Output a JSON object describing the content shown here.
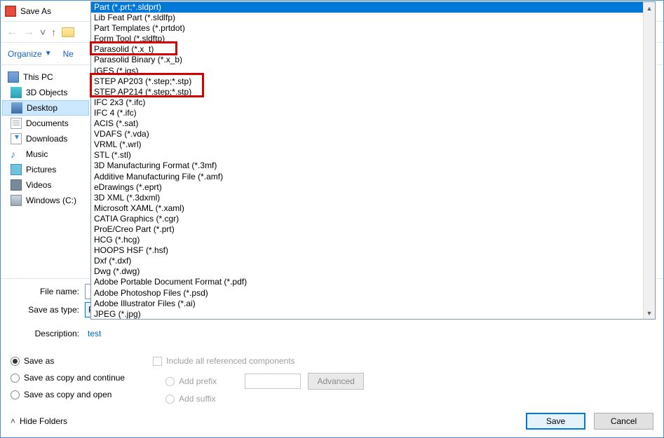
{
  "titlebar": {
    "title": "Save As"
  },
  "toolbar": {
    "organize": "Organize",
    "newfolder_prefix": "Ne"
  },
  "sidebar": {
    "items": [
      {
        "label": "This PC",
        "type": "top"
      },
      {
        "label": "3D Objects"
      },
      {
        "label": "Desktop",
        "selected": true
      },
      {
        "label": "Documents"
      },
      {
        "label": "Downloads"
      },
      {
        "label": "Music"
      },
      {
        "label": "Pictures"
      },
      {
        "label": "Videos"
      },
      {
        "label": "Windows (C:)"
      }
    ]
  },
  "dropdown": {
    "items": [
      "Part (*.prt;*.sldprt)",
      "Lib Feat Part (*.sldlfp)",
      "Part Templates (*.prtdot)",
      "Form Tool (*.sldftp)",
      "Parasolid (*.x_t)",
      "Parasolid Binary (*.x_b)",
      "IGES (*.igs)",
      "STEP AP203 (*.step;*.stp)",
      "STEP AP214 (*.step;*.stp)",
      "IFC 2x3 (*.ifc)",
      "IFC 4 (*.ifc)",
      "ACIS (*.sat)",
      "VDAFS (*.vda)",
      "VRML (*.wrl)",
      "STL (*.stl)",
      "3D Manufacturing Format (*.3mf)",
      "Additive Manufacturing File (*.amf)",
      "eDrawings (*.eprt)",
      "3D XML (*.3dxml)",
      "Microsoft XAML (*.xaml)",
      "CATIA Graphics (*.cgr)",
      "ProE/Creo Part (*.prt)",
      "HCG (*.hcg)",
      "HOOPS HSF (*.hsf)",
      "Dxf (*.dxf)",
      "Dwg (*.dwg)",
      "Adobe Portable Document Format (*.pdf)",
      "Adobe Photoshop Files (*.psd)",
      "Adobe Illustrator Files (*.ai)",
      "JPEG (*.jpg)"
    ],
    "selected_index": 0
  },
  "form": {
    "filename_label": "File name:",
    "saveastype_label": "Save as type:",
    "saveastype_value": "Part (*.prt;*.sldprt)",
    "description_label": "Description:",
    "description_value": "test"
  },
  "options": {
    "save_as": "Save as",
    "save_copy_continue": "Save as copy and continue",
    "save_copy_open": "Save as copy and open",
    "include_all": "Include all referenced components",
    "add_prefix": "Add prefix",
    "add_suffix": "Add suffix",
    "advanced": "Advanced"
  },
  "footer": {
    "hide_folders": "Hide Folders",
    "save": "Save",
    "cancel": "Cancel"
  }
}
